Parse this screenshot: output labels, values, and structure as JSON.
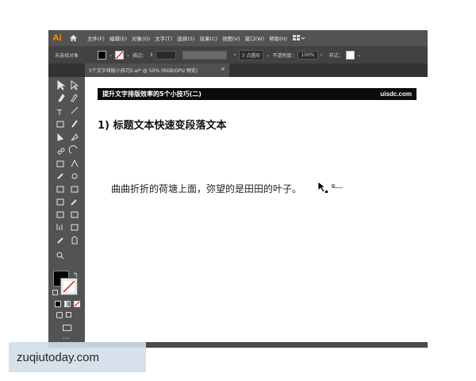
{
  "menubar": {
    "app_logo": "Ai",
    "home_icon": "home-icon",
    "items": [
      "文件(F)",
      "编辑(E)",
      "对象(O)",
      "文字(T)",
      "选择(S)",
      "效果(C)",
      "视图(V)",
      "窗口(W)",
      "帮助(H)"
    ],
    "workspace_icon": "workspace-switcher-icon"
  },
  "controlbar": {
    "no_selection": "未选择对象",
    "stroke_label": "描边：",
    "brush_label": "3 点圆形",
    "opacity_label": "不透明度：",
    "opacity_value": "100%",
    "style_label": "样式："
  },
  "document_tab": {
    "label": "5个文字排版小技巧5.ai* @ 50% (RGB/GPU 预览)",
    "close": "×"
  },
  "canvas": {
    "banner_title": "提升文字排版效率的5个小技巧(二)",
    "banner_site": "uisdc.com",
    "heading": "1) 标题文本快速变段落文本",
    "body_text": "曲曲折折的荷塘上面，弥望的是田田的叶子。"
  },
  "watermark": {
    "text": "zuqiutoday.com"
  },
  "colors": {
    "app_bg": "#323232",
    "menubar_bg": "#535353",
    "ai_logo": "#ff9a00",
    "fill_swatch": "#000000",
    "stroke_swatch": "#ffffff"
  }
}
